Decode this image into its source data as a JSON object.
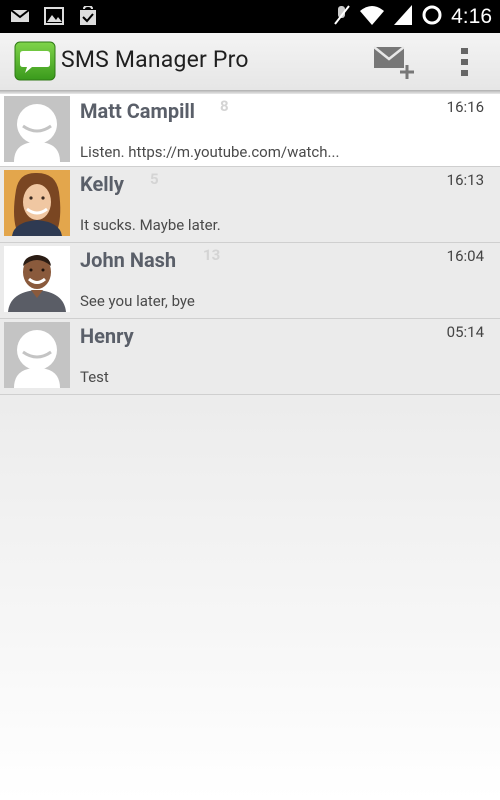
{
  "status_bar": {
    "time": "4:16",
    "icons": [
      "gmail-icon",
      "gallery-icon",
      "play-store-icon",
      "mute-icon",
      "wifi-icon",
      "signal-icon",
      "loading-icon"
    ]
  },
  "app": {
    "title": "SMS Manager Pro"
  },
  "conversations": [
    {
      "name": "Matt Campill",
      "count": "8",
      "time": "16:16",
      "preview": "Listen. https://m.youtube.com/watch..."
    },
    {
      "name": "Kelly",
      "count": "5",
      "time": "16:13",
      "preview": "It sucks. Maybe later."
    },
    {
      "name": "John Nash",
      "count": "13",
      "time": "16:04",
      "preview": "See you later, bye"
    },
    {
      "name": "Henry",
      "count": "",
      "time": "05:14",
      "preview": "Test"
    }
  ]
}
